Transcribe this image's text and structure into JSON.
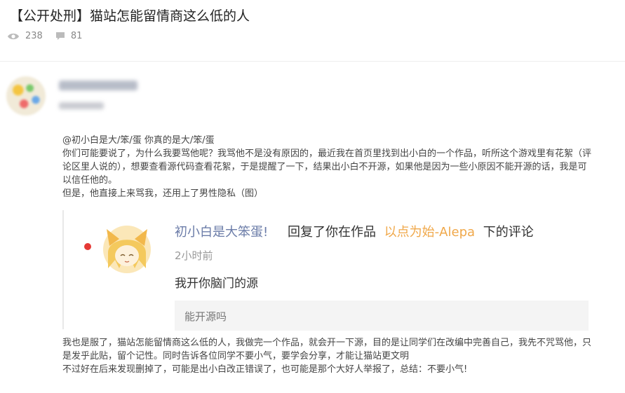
{
  "post": {
    "title": "【公开处刑】猫站怎能留情商这么低的人",
    "views": "238",
    "comments": "81"
  },
  "author": {
    "name": "[blurred name]",
    "sub": "[blurred info]"
  },
  "content": {
    "line1": "@初小白是大/笨/蛋  你真的是大/笨/蛋",
    "para1": "你们可能要说了，为什么我要骂他呢？我骂他不是没有原因的，最近我在首页里找到出小白的一个作品，听所这个游戏里有花絮（评论区里人说的），想要查看源代码查看花絮，于是提醒了一下，结果出小白不开源，如果他是因为一些小原因不能开源的话，我是可以信任他的。",
    "para2": "但是，他直接上来骂我，还用上了男性隐私（图）",
    "para3": "我也是服了，猫站怎能留情商这么低的人，我做完一个作品，就会开一下源，目的是让同学们在改编中完善自己，我先不咒骂他，只是发乎此贴，留个记性。同时告诉各位同学不要小气，要学会分享，才能让猫站更文明",
    "para4": "不过好在后来发现删掉了，可能是出小白改正错误了，也可能是那个大好人举报了，总结：不要小气!"
  },
  "screenshot": {
    "replier": "初小白是大笨蛋!",
    "action_pre": "回复了你在作品",
    "work": "以点为始-Alepa",
    "action_post": "下的评论",
    "time": "2小时前",
    "reply": "我开你脑门的源",
    "quoted": "能开源吗"
  }
}
